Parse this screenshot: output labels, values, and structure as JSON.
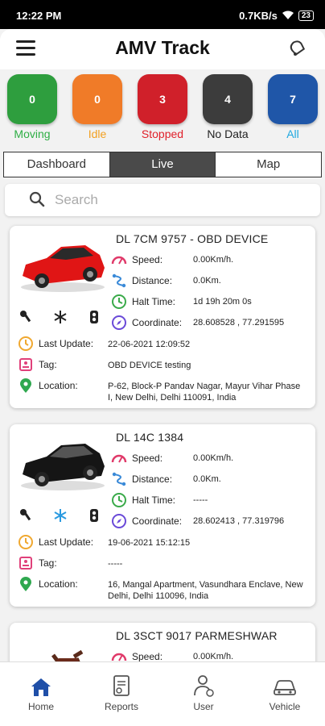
{
  "status_bar": {
    "time": "12:22 PM",
    "speed": "0.7KB/s",
    "battery": "23"
  },
  "header": {
    "title": "AMV Track"
  },
  "statuses": [
    {
      "count": "0",
      "label": "Moving",
      "color": "#2e9e3e",
      "label_color": "#2fae45"
    },
    {
      "count": "0",
      "label": "Idle",
      "color": "#f07b28",
      "label_color": "#f3a020"
    },
    {
      "count": "3",
      "label": "Stopped",
      "color": "#d0202a",
      "label_color": "#e0202a"
    },
    {
      "count": "4",
      "label": "No Data",
      "color": "#3c3c3c",
      "label_color": "#222222"
    },
    {
      "count": "7",
      "label": "All",
      "color": "#1f56a8",
      "label_color": "#20a8e0"
    }
  ],
  "tabs": [
    {
      "label": "Dashboard",
      "active": false
    },
    {
      "label": "Live",
      "active": true
    },
    {
      "label": "Map",
      "active": false
    }
  ],
  "search": {
    "placeholder": "Search",
    "value": ""
  },
  "stat_labels": {
    "speed": "Speed:",
    "distance": "Distance:",
    "halt": "Halt Time:",
    "coordinate": "Coordinate:"
  },
  "info_labels": {
    "last_update": "Last Update:",
    "tag": "Tag:",
    "location": "Location:"
  },
  "vehicles": [
    {
      "name": "DL 7CM 9757 - OBD DEVICE",
      "speed": "0.00Km/h.",
      "distance": "0.0Km.",
      "halt_time": "1d 19h 20m 0s",
      "coordinate": "28.608528 , 77.291595",
      "last_update": "22-06-2021 12:09:52",
      "tag": "OBD DEVICE testing",
      "location": "P-62, Block-P Pandav Nagar, Mayur Vihar Phase I, New Delhi, Delhi 110091, India",
      "car_color": "#e01515"
    },
    {
      "name": "DL 14C 1384",
      "speed": "0.00Km/h.",
      "distance": "0.0Km.",
      "halt_time": "-----",
      "coordinate": "28.602413 , 77.319796",
      "last_update": "19-06-2021 15:12:15",
      "tag": "-----",
      "location": "16, Mangal Apartment, Vasundhara Enclave, New Delhi, Delhi 110096, India",
      "car_color": "#151515"
    },
    {
      "name": "DL 3SCT 9017 PARMESHWAR",
      "speed": "0.00Km/h."
    }
  ],
  "bottom_nav": [
    {
      "label": "Home",
      "icon": "home-icon",
      "active": true
    },
    {
      "label": "Reports",
      "icon": "reports-icon",
      "active": false
    },
    {
      "label": "User",
      "icon": "user-icon",
      "active": false
    },
    {
      "label": "Vehicle",
      "icon": "vehicle-icon",
      "active": false
    }
  ]
}
